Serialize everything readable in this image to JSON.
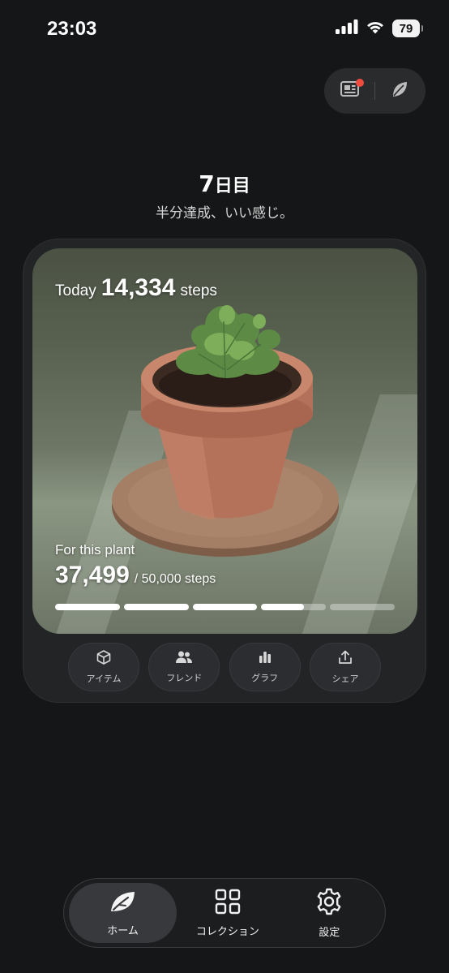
{
  "status_bar": {
    "time": "23:03",
    "battery": "79",
    "icons": [
      "signal-icon",
      "wifi-icon",
      "battery-icon"
    ]
  },
  "top_actions": {
    "icons": [
      "news-icon",
      "leaf-icon"
    ],
    "notification_dot_color": "#ef4b3e"
  },
  "day": {
    "number": "7",
    "suffix": "日目",
    "message": "半分達成、いい感じ。"
  },
  "card": {
    "today_label": "Today",
    "today_steps": "14,334",
    "today_unit": "steps",
    "plant_label": "For this plant",
    "plant_steps": "37,499",
    "plant_goal": "/ 50,000 steps",
    "progress_segments": [
      1,
      1,
      1,
      0.66,
      0
    ],
    "image_icon": "potted-plant-photo"
  },
  "actions": [
    {
      "label": "アイテム",
      "icon": "box-icon"
    },
    {
      "label": "フレンド",
      "icon": "friends-icon"
    },
    {
      "label": "グラフ",
      "icon": "bar-chart-icon"
    },
    {
      "label": "シェア",
      "icon": "share-icon"
    }
  ],
  "tabbar": {
    "tabs": [
      {
        "label": "ホーム",
        "icon": "leaf-icon",
        "active": true
      },
      {
        "label": "コレクション",
        "icon": "grid-icon",
        "active": false
      },
      {
        "label": "設定",
        "icon": "gear-icon",
        "active": false
      }
    ]
  },
  "colors": {
    "background": "#151617",
    "card": "#232426",
    "accent_white": "#ffffff",
    "notification": "#ef4b3e"
  }
}
